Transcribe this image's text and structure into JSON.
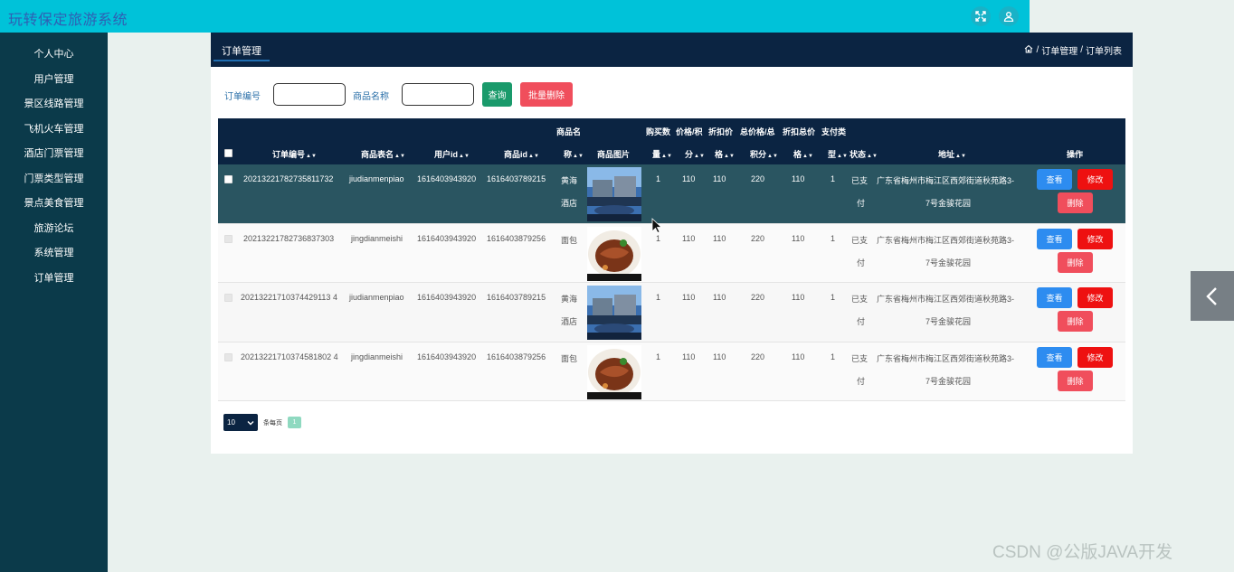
{
  "app": {
    "title": "玩转保定旅游系统"
  },
  "topbar": {
    "fullscreen_icon": "fullscreen-icon",
    "user_icon": "user-icon"
  },
  "sidebar": {
    "items": [
      {
        "label": "个人中心"
      },
      {
        "label": "用户管理"
      },
      {
        "label": "景区线路管理"
      },
      {
        "label": "飞机火车管理"
      },
      {
        "label": "酒店门票管理"
      },
      {
        "label": "门票类型管理"
      },
      {
        "label": "景点美食管理"
      },
      {
        "label": "旅游论坛"
      },
      {
        "label": "系统管理"
      },
      {
        "label": "订单管理"
      }
    ]
  },
  "panel": {
    "tab": "订单管理",
    "breadcrumb": {
      "home_icon": "home-icon",
      "level1": "订单管理",
      "level2": "订单列表",
      "sep": "/"
    }
  },
  "filters": {
    "order_no_label": "订单编号",
    "order_no_value": "",
    "goods_name_label": "商品名称",
    "goods_name_value": "",
    "query_button": "查询",
    "batch_delete_button": "批量删除"
  },
  "table": {
    "headers": {
      "order_no": "订单编号",
      "table_name": "商品表名",
      "user_id": "用户id",
      "goods_id": "商品id",
      "goods_name_1": "商品名",
      "goods_name_2": "称",
      "goods_image": "商品图片",
      "qty_1": "购买数",
      "qty_2": "量",
      "price_1": "价格/积",
      "price_2": "分",
      "discount_1": "折扣价",
      "discount_2": "格",
      "total_1": "总价格/总",
      "total_2": "积分",
      "discount_total_1": "折扣总价",
      "discount_total_2": "格",
      "pay_type_1": "支付类",
      "pay_type_2": "型",
      "status": "状态",
      "address": "地址",
      "actions": "操作"
    },
    "rows": [
      {
        "order_no": "20213221782735811732",
        "table_name": "jiudianmenpiao",
        "user_id": "1616403943920",
        "goods_id": "1616403789215",
        "goods_name_1": "黄海",
        "goods_name_2": "酒店",
        "image": "hotel",
        "qty": "1",
        "price": "110",
        "discount": "110",
        "total": "220",
        "discount_total": "110",
        "pay_type": "1",
        "status_1": "已支",
        "status_2": "付",
        "address_1": "广东省梅州市梅江区西郊街道秋苑路3-",
        "address_2": "7号金骏花园"
      },
      {
        "order_no": "20213221782736837303",
        "table_name": "jingdianmeishi",
        "user_id": "1616403943920",
        "goods_id": "1616403879256",
        "goods_name_1": "面包",
        "goods_name_2": "",
        "image": "food",
        "qty": "1",
        "price": "110",
        "discount": "110",
        "total": "220",
        "discount_total": "110",
        "pay_type": "1",
        "status_1": "已支",
        "status_2": "付",
        "address_1": "广东省梅州市梅江区西郊街道秋苑路3-",
        "address_2": "7号金骏花园"
      },
      {
        "order_no": "20213221710374429113 4",
        "table_name": "jiudianmenpiao",
        "user_id": "1616403943920",
        "goods_id": "1616403789215",
        "goods_name_1": "黄海",
        "goods_name_2": "酒店",
        "image": "hotel",
        "qty": "1",
        "price": "110",
        "discount": "110",
        "total": "220",
        "discount_total": "110",
        "pay_type": "1",
        "status_1": "已支",
        "status_2": "付",
        "address_1": "广东省梅州市梅江区西郊街道秋苑路3-",
        "address_2": "7号金骏花园"
      },
      {
        "order_no": "20213221710374581802 4",
        "table_name": "jingdianmeishi",
        "user_id": "1616403943920",
        "goods_id": "1616403879256",
        "goods_name_1": "面包",
        "goods_name_2": "",
        "image": "food",
        "qty": "1",
        "price": "110",
        "discount": "110",
        "total": "220",
        "discount_total": "110",
        "pay_type": "1",
        "status_1": "已支",
        "status_2": "付",
        "address_1": "广东省梅州市梅江区西郊街道秋苑路3-",
        "address_2": "7号金骏花园"
      }
    ],
    "actions": {
      "view": "查看",
      "edit": "修改",
      "delete": "删除"
    }
  },
  "pager": {
    "page_size": "10",
    "text": "条每页",
    "current_page": "1"
  },
  "watermark": "CSDN @公版JAVA开发",
  "colors": {
    "topbar": "#00c2d9",
    "sidebar": "#0b3a4a",
    "header": "#0b2442",
    "selected_row": "#2a5561"
  }
}
